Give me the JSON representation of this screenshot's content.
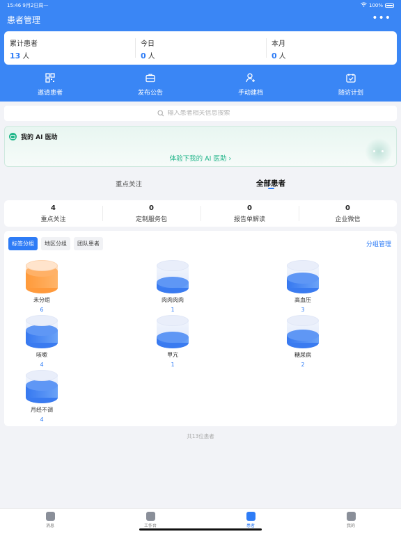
{
  "status": {
    "time": "15:46",
    "date": "9月2日周一",
    "battery": "100%"
  },
  "header": {
    "title": "患者管理",
    "more": "•••"
  },
  "stats": [
    {
      "label": "累计患者",
      "value": "13",
      "unit": "人"
    },
    {
      "label": "今日",
      "value": "0",
      "unit": "人"
    },
    {
      "label": "本月",
      "value": "0",
      "unit": "人"
    }
  ],
  "quick_actions": [
    {
      "label": "邀请患者",
      "icon": "qr-code-icon"
    },
    {
      "label": "发布公告",
      "icon": "briefcase-icon"
    },
    {
      "label": "手动建档",
      "icon": "add-user-icon"
    },
    {
      "label": "随访计划",
      "icon": "calendar-check-icon"
    }
  ],
  "search": {
    "placeholder": "输入患者相关信息搜索"
  },
  "ai": {
    "title": "我的 AI 医助",
    "link": "体验下我的 AI 医助 ›"
  },
  "tabs": {
    "focus": "重点关注",
    "all": "全部患者"
  },
  "counts": [
    {
      "value": "4",
      "label": "重点关注"
    },
    {
      "value": "0",
      "label": "定制服务包"
    },
    {
      "value": "0",
      "label": "报告单解读"
    },
    {
      "value": "0",
      "label": "企业微信"
    }
  ],
  "group_tabs": [
    "标签分组",
    "地区分组",
    "团队患者"
  ],
  "group_manage": "分组管理",
  "groups": [
    {
      "name": "未分组",
      "count": "6",
      "color": "#ff9a3c",
      "level": 0.75
    },
    {
      "name": "肉肉肉肉",
      "count": "1",
      "color": "#3a7bf0",
      "level": 0.25
    },
    {
      "name": "高血压",
      "count": "3",
      "color": "#3a7bf0",
      "level": 0.45
    },
    {
      "name": "咳嗽",
      "count": "4",
      "color": "#3a7bf0",
      "level": 0.55
    },
    {
      "name": "甲亢",
      "count": "1",
      "color": "#3a7bf0",
      "level": 0.25
    },
    {
      "name": "糖尿病",
      "count": "2",
      "color": "#3a7bf0",
      "level": 0.35
    },
    {
      "name": "月经不调",
      "count": "4",
      "color": "#3a7bf0",
      "level": 0.55
    }
  ],
  "total": "共13位患者",
  "tabbar": [
    {
      "label": "消息",
      "icon": "chat-icon",
      "active": false
    },
    {
      "label": "工作台",
      "icon": "home-icon",
      "active": false
    },
    {
      "label": "患者",
      "icon": "patients-icon",
      "active": true
    },
    {
      "label": "我的",
      "icon": "profile-icon",
      "active": false
    }
  ]
}
